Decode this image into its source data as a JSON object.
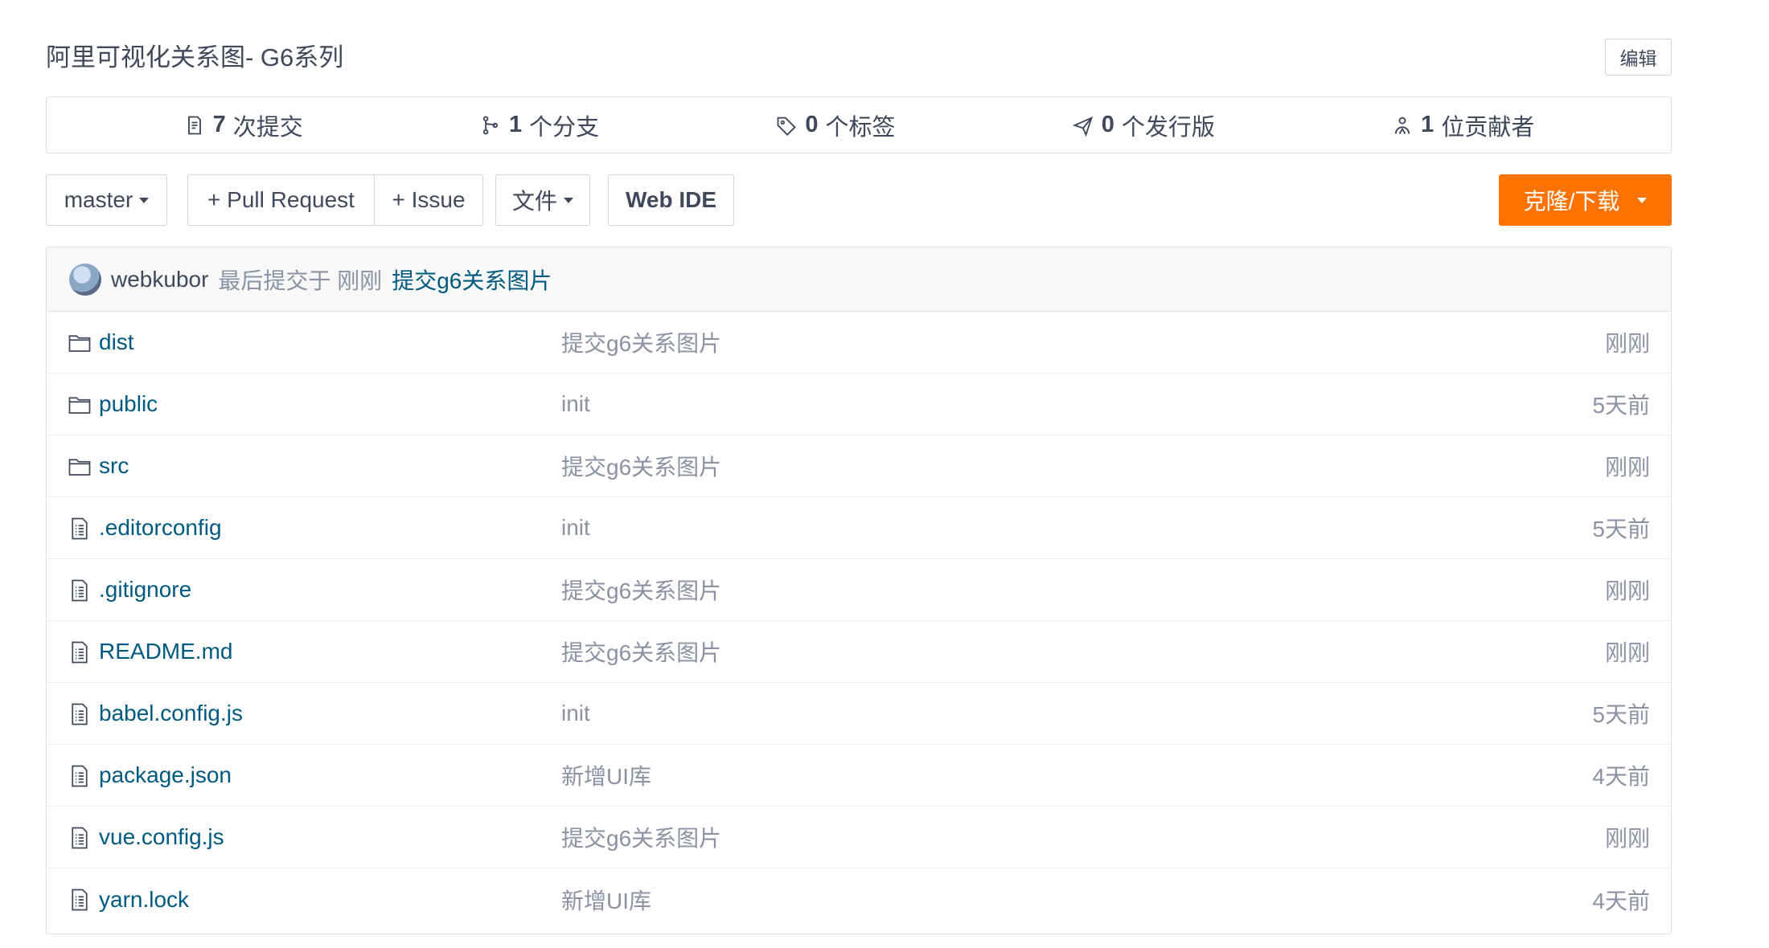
{
  "header": {
    "title": "阿里可视化关系图- G6系列",
    "edit_label": "编辑"
  },
  "stats": [
    {
      "icon": "commit-icon",
      "count": "7",
      "label": "次提交"
    },
    {
      "icon": "branch-icon",
      "count": "1",
      "label": "个分支"
    },
    {
      "icon": "tag-icon",
      "count": "0",
      "label": "个标签"
    },
    {
      "icon": "release-icon",
      "count": "0",
      "label": "个发行版"
    },
    {
      "icon": "contributors-icon",
      "count": "1",
      "label": "位贡献者"
    }
  ],
  "toolbar": {
    "branch": "master",
    "pull_request": "+ Pull Request",
    "issue": "+ Issue",
    "file_menu": "文件",
    "web_ide": "Web IDE",
    "clone": "克隆/下载"
  },
  "latest_commit": {
    "author": "webkubor",
    "meta": "最后提交于 刚刚",
    "message": "提交g6关系图片"
  },
  "files": [
    {
      "type": "folder",
      "name": "dist",
      "message": "提交g6关系图片",
      "time": "刚刚"
    },
    {
      "type": "folder",
      "name": "public",
      "message": "init",
      "time": "5天前"
    },
    {
      "type": "folder",
      "name": "src",
      "message": "提交g6关系图片",
      "time": "刚刚"
    },
    {
      "type": "file",
      "name": ".editorconfig",
      "message": "init",
      "time": "5天前"
    },
    {
      "type": "file",
      "name": ".gitignore",
      "message": "提交g6关系图片",
      "time": "刚刚"
    },
    {
      "type": "file",
      "name": "README.md",
      "message": "提交g6关系图片",
      "time": "刚刚"
    },
    {
      "type": "file",
      "name": "babel.config.js",
      "message": "init",
      "time": "5天前"
    },
    {
      "type": "file",
      "name": "package.json",
      "message": "新增UI库",
      "time": "4天前"
    },
    {
      "type": "file",
      "name": "vue.config.js",
      "message": "提交g6关系图片",
      "time": "刚刚"
    },
    {
      "type": "file",
      "name": "yarn.lock",
      "message": "新增UI库",
      "time": "4天前"
    }
  ],
  "colors": {
    "accent_orange": "#fe7300",
    "link_blue": "#005980",
    "muted_text": "#8c92a4"
  }
}
